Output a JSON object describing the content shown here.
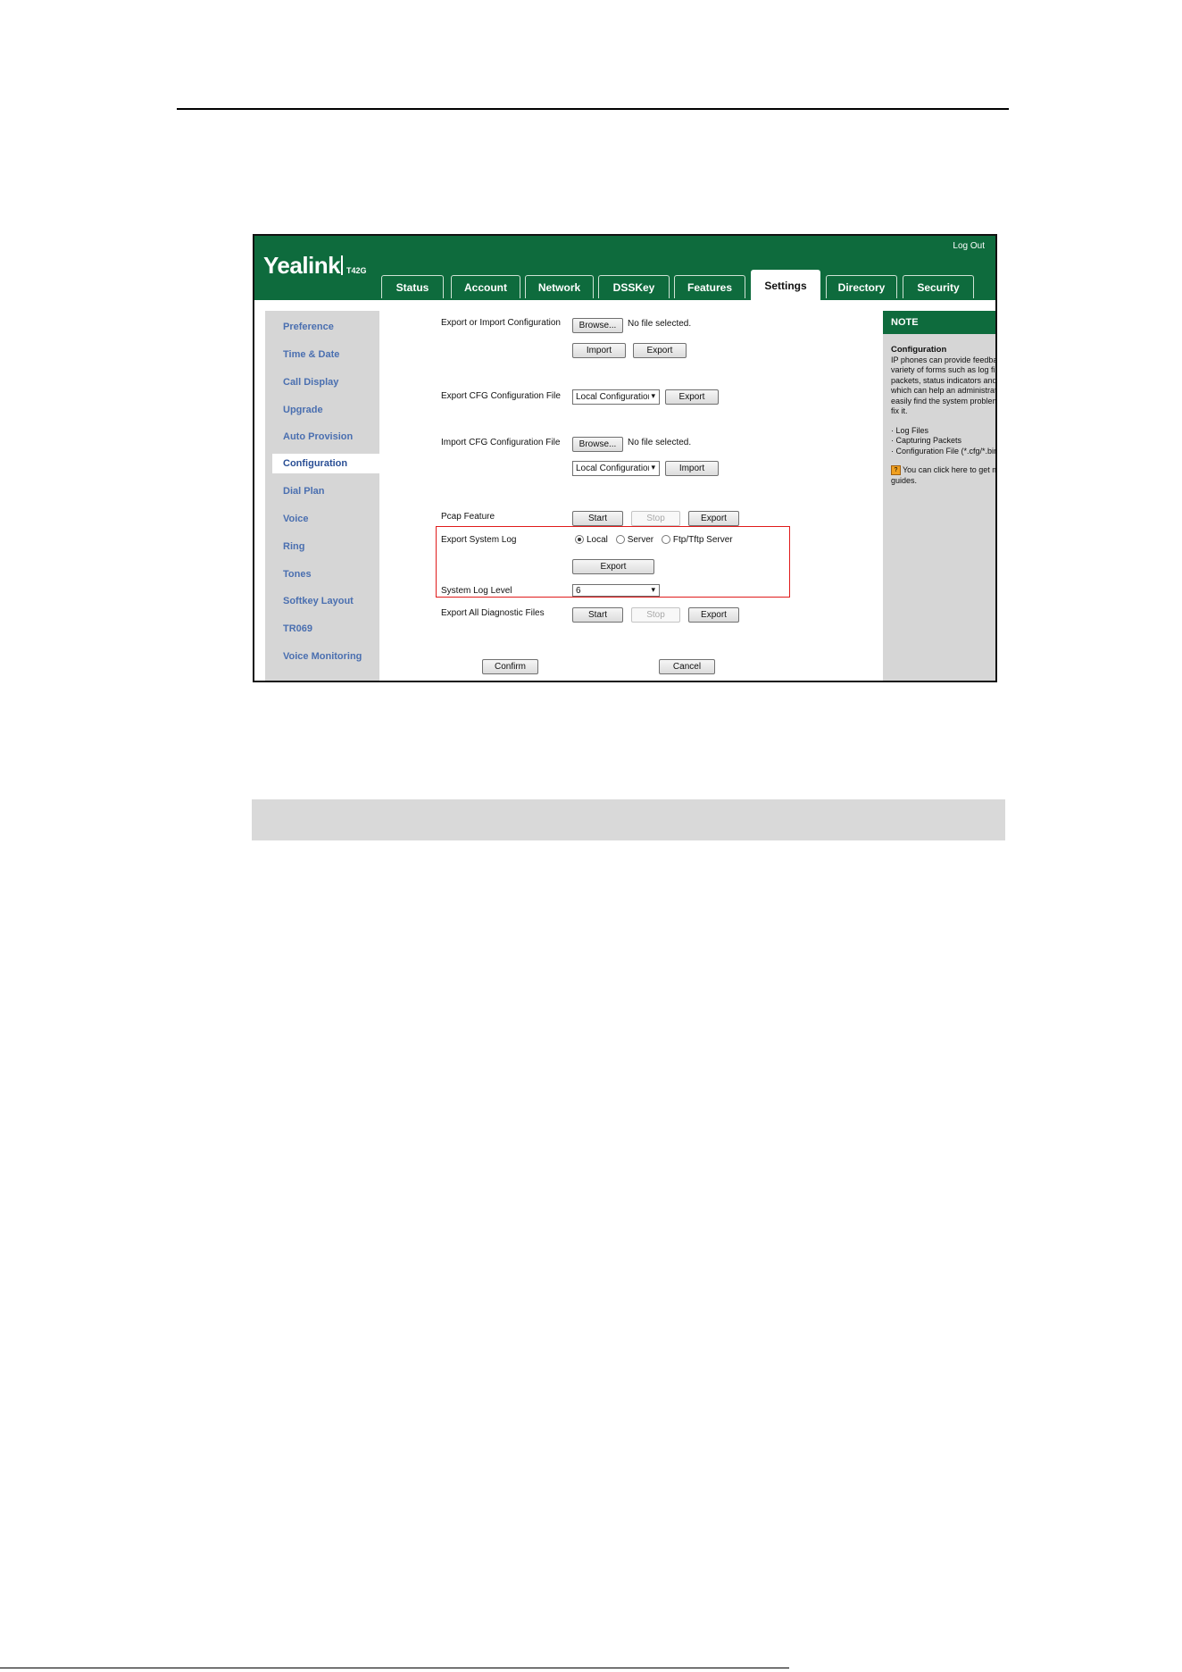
{
  "app": {
    "logo": "Yealink",
    "model": "T42G",
    "logout": "Log Out"
  },
  "tabs": [
    {
      "label": "Status"
    },
    {
      "label": "Account"
    },
    {
      "label": "Network"
    },
    {
      "label": "DSSKey"
    },
    {
      "label": "Features"
    },
    {
      "label": "Settings",
      "active": true
    },
    {
      "label": "Directory"
    },
    {
      "label": "Security"
    }
  ],
  "sidebar": {
    "items": [
      {
        "label": "Preference"
      },
      {
        "label": "Time & Date"
      },
      {
        "label": "Call Display"
      },
      {
        "label": "Upgrade"
      },
      {
        "label": "Auto Provision"
      },
      {
        "label": "Configuration",
        "active": true
      },
      {
        "label": "Dial Plan"
      },
      {
        "label": "Voice"
      },
      {
        "label": "Ring"
      },
      {
        "label": "Tones"
      },
      {
        "label": "Softkey Layout"
      },
      {
        "label": "TR069"
      },
      {
        "label": "Voice Monitoring"
      }
    ]
  },
  "form": {
    "export_import_config": {
      "label": "Export or Import Configuration",
      "browse": "Browse...",
      "file_status": "No file selected.",
      "import": "Import",
      "export": "Export"
    },
    "export_cfg": {
      "label": "Export CFG Configuration File",
      "select_value": "Local Configuration",
      "export": "Export"
    },
    "import_cfg": {
      "label": "Import CFG Configuration File",
      "browse": "Browse...",
      "file_status": "No file selected.",
      "select_value": "Local Configuration",
      "import": "Import"
    },
    "pcap": {
      "label": "Pcap Feature",
      "start": "Start",
      "stop": "Stop",
      "export": "Export"
    },
    "system_log": {
      "label": "Export System Log",
      "options": [
        "Local",
        "Server",
        "Ftp/Tftp Server"
      ],
      "selected": "Local",
      "export": "Export"
    },
    "log_level": {
      "label": "System Log Level",
      "value": "6"
    },
    "diagnostic": {
      "label": "Export All Diagnostic Files",
      "start": "Start",
      "stop": "Stop",
      "export": "Export"
    },
    "confirm": "Confirm",
    "cancel": "Cancel"
  },
  "note": {
    "heading": "NOTE",
    "title": "Configuration",
    "text": "IP phones can provide feedback in a variety of forms such as log files, packets, status indicators and so on, which can help an administrator more easily find the system problem and fix it.",
    "bullets": [
      "Log Files",
      "Capturing Packets",
      "Configuration File (*.cfg/*.bin)"
    ],
    "help_icon": "?",
    "help": "You can click here to get more guides."
  },
  "colors": {
    "header_green": "#0e6b3d",
    "nav_gray": "#d6d6d6",
    "nav_link": "#4a6fb0",
    "highlight_red": "#e01b1b",
    "note_corner": "#ff8c1a"
  }
}
